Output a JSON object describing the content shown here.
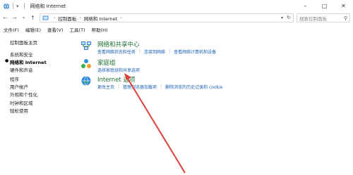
{
  "window": {
    "title": "网络和 Internet"
  },
  "address": {
    "crumbs": [
      "控制面板",
      "网络和 Internet"
    ],
    "search_placeholder": "搜索控制面板"
  },
  "menu": {
    "items": [
      "文件(F)",
      "编辑(E)",
      "查看(V)",
      "工具(T)",
      "帮助(H)"
    ]
  },
  "sidebar": {
    "home": "控制面板主页",
    "items": [
      {
        "label": "系统和安全",
        "active": false
      },
      {
        "label": "网络和 Internet",
        "active": true
      },
      {
        "label": "硬件和声音",
        "active": false
      },
      {
        "label": "程序",
        "active": false
      },
      {
        "label": "用户帐户",
        "active": false
      },
      {
        "label": "外观和个性化",
        "active": false
      },
      {
        "label": "时钟和区域",
        "active": false
      },
      {
        "label": "轻松使用",
        "active": false
      }
    ]
  },
  "sections": [
    {
      "title": "网络和共享中心",
      "icon": "network-sharing-center-icon",
      "links": [
        "查看网络状态和任务",
        "连接到网络",
        "查看网络计算机和设备"
      ]
    },
    {
      "title": "家庭组",
      "icon": "homegroup-icon",
      "links": [
        "选择家庭组和共享选项"
      ]
    },
    {
      "title": "Internet 选项",
      "icon": "internet-options-icon",
      "links": [
        "更改主页",
        "管理浏览器加载项",
        "删除浏览的历史记录和 cookie"
      ]
    }
  ],
  "colors": {
    "section_title": "#1a6e2e",
    "link": "#1a5fb4",
    "annotation_arrow": "#e0403a"
  }
}
